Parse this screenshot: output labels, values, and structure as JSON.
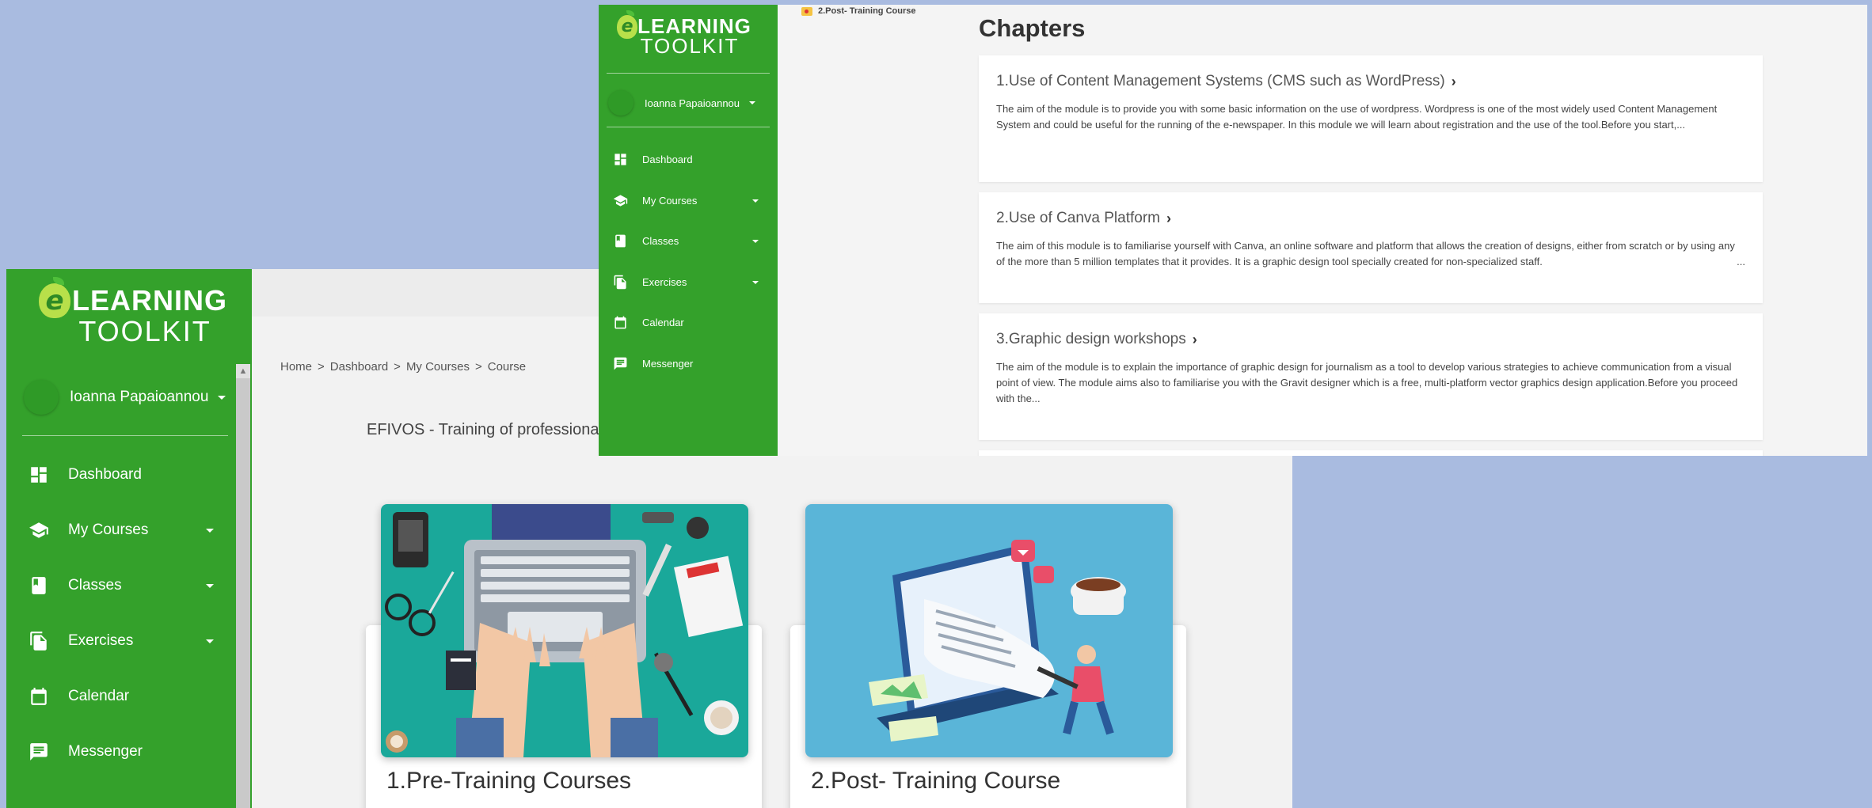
{
  "back_window": {
    "logo": {
      "letter": "e",
      "line1": "LEARNING",
      "line2": "TOOLKIT"
    },
    "user": {
      "name": "Ioanna Papaioannou"
    },
    "nav": [
      {
        "label": "Dashboard",
        "icon": "dashboard-icon",
        "has_caret": false
      },
      {
        "label": "My Courses",
        "icon": "graduation-cap-icon",
        "has_caret": true
      },
      {
        "label": "Classes",
        "icon": "book-icon",
        "has_caret": true
      },
      {
        "label": "Exercises",
        "icon": "documents-icon",
        "has_caret": true
      },
      {
        "label": "Calendar",
        "icon": "calendar-icon",
        "has_caret": false
      },
      {
        "label": "Messenger",
        "icon": "chat-icon",
        "has_caret": false
      }
    ],
    "breadcrumb": [
      "Home",
      "Dashboard",
      "My Courses",
      "Course"
    ],
    "breadcrumb_separator": ">",
    "course_subtitle": "EFIVOS - Training of professionals",
    "cards": [
      {
        "title": "1.Pre-Training Courses",
        "image": "laptop-desk-illustration"
      },
      {
        "title": "2.Post- Training Course",
        "image": "document-illustration"
      }
    ]
  },
  "front_window": {
    "logo": {
      "letter": "e",
      "line1": "LEARNING",
      "line2": "TOOLKIT"
    },
    "user": {
      "name": "Ioanna Papaioannou"
    },
    "nav": [
      {
        "label": "Dashboard",
        "icon": "dashboard-icon",
        "has_caret": false
      },
      {
        "label": "My Courses",
        "icon": "graduation-cap-icon",
        "has_caret": true
      },
      {
        "label": "Classes",
        "icon": "book-icon",
        "has_caret": true
      },
      {
        "label": "Exercises",
        "icon": "documents-icon",
        "has_caret": true
      },
      {
        "label": "Calendar",
        "icon": "calendar-icon",
        "has_caret": false
      },
      {
        "label": "Messenger",
        "icon": "chat-icon",
        "has_caret": false
      }
    ],
    "tab_label": "2.Post- Training Course",
    "chapters_title": "Chapters",
    "chapters": [
      {
        "title": "1.Use of Content Management Systems (CMS such as WordPress)",
        "description": "The aim of the module is to provide you with some basic information on the use of wordpress. Wordpress is one of the most widely used Content Management System and could be useful for the running of the e-newspaper. In this module we will learn about registration and the use of the tool.Before you start,..."
      },
      {
        "title": "2.Use of Canva Platform",
        "description": "The aim of this module is to familiarise yourself with Canva, an online software and platform that allows the creation of designs, either from scratch or by using any of the more than 5 million templates that it provides. It is a graphic design tool specially created for non-specialized staff.",
        "ellipsis": "..."
      },
      {
        "title": "3.Graphic design workshops",
        "description": "The aim of the module is to explain the importance of graphic design for journalism as a tool to develop various strategies to achieve communication from a visual point of view. The module aims also to familiarise you with the Gravit designer which is a free, multi-platform vector graphics design application.Before you proceed with the..."
      }
    ],
    "chevron": "›"
  },
  "colors": {
    "background": "#a9bbe0",
    "sidebar_green": "#34a12b",
    "card_teal": "#1aa89a",
    "card_blue": "#5ab5d8"
  }
}
